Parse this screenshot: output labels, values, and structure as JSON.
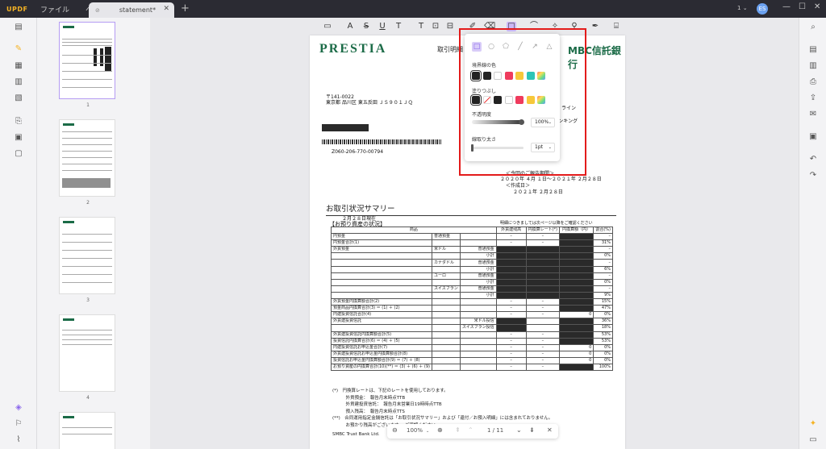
{
  "app": {
    "logo": "UPDF",
    "menus": [
      "ファイル",
      "ヘルプ"
    ],
    "tab_title": "statement*",
    "tab_close": "✕",
    "tab_add": "+",
    "user_count": "1",
    "avatar_initials": "ES",
    "win_min": "—",
    "win_max": "☐",
    "win_close": "✕"
  },
  "thumbnails": {
    "pages": [
      "1",
      "2",
      "3",
      "4"
    ]
  },
  "popup": {
    "border_color_label": "境界線の色",
    "fill_label": "塗りつぶし",
    "opacity_label": "不透明度",
    "opacity_value": "100%",
    "stroke_width_label": "線取り太さ",
    "stroke_width_value": "1pt",
    "border_colors": [
      "#222222",
      "#222222",
      "#ffffff",
      "#ef3b5d",
      "#f7c83a",
      "#2ec4b6",
      "#7a6cf0"
    ],
    "fill_colors": [
      "#222222",
      "none",
      "#222222",
      "#ffffff",
      "#ef3b5d",
      "#f7c83a",
      "#7a6cf0"
    ]
  },
  "document": {
    "brand": "PRESTIA",
    "doc_title": "取引明細",
    "bank": "MBC信託銀行",
    "postal": "〒141-0022",
    "address": "東京都 品川区 東五反田 ＪＳ９０１ＪＱ",
    "code": "Z060-206-770-00794",
    "right1": "ライン",
    "right2": "バンキング",
    "period_label": "＜今回のご報告期間＞",
    "period": "２０２０年 ４月 １日～２０２１年 ２月２８日",
    "created_label": "＜作成日＞",
    "created": "２０２１年 ２月２８日",
    "section_title": "お取引状況サマリー",
    "as_of": "２月２８日現在",
    "holdings_title": "【お預り資産の状況】",
    "holdings_note": "明細につきましては次ページ以降をご確認ください",
    "table_headers": [
      "商品",
      "外貨建残高",
      "円換算レート(*)",
      "円換算額（円）",
      "割合(%)"
    ],
    "rows": [
      [
        "円預金",
        "普通預金",
        "",
        "–",
        "–",
        "",
        "–"
      ],
      [
        "円預金合計(1)",
        "",
        "",
        "–",
        "–",
        "",
        "31%"
      ],
      [
        "外貨預金",
        "米ドル",
        "普通預金",
        "",
        "",
        "",
        "–"
      ],
      [
        "",
        "",
        "小計",
        "",
        "",
        "",
        "0%"
      ],
      [
        "",
        "カナダドル",
        "普通預金",
        "",
        "",
        "",
        "–"
      ],
      [
        "",
        "",
        "小計",
        "",
        "",
        "",
        "6%"
      ],
      [
        "",
        "ユーロ",
        "普通預金",
        "",
        "",
        "",
        "–"
      ],
      [
        "",
        "",
        "小計",
        "",
        "",
        "",
        "0%"
      ],
      [
        "",
        "スイスフラン",
        "普通預金",
        "",
        "",
        "",
        "–"
      ],
      [
        "",
        "",
        "小計",
        "",
        "",
        "",
        "9%"
      ],
      [
        "外貨預金円換算額合計(2)",
        "",
        "",
        "–",
        "–",
        "",
        "15%"
      ],
      [
        "預金商品円換算合計(3) ＝ (1) ＋ (2)",
        "",
        "",
        "–",
        "–",
        "",
        "47%"
      ],
      [
        "円建投資信託合計(4)",
        "",
        "",
        "–",
        "–",
        "0",
        "0%"
      ],
      [
        "外貨建投資信託",
        "",
        "米ドル投信",
        "",
        "",
        "",
        "36%"
      ],
      [
        "",
        "",
        "スイスフラン投信",
        "",
        "",
        "",
        "18%"
      ],
      [
        "外貨建投資信託円換算額合計(5)",
        "",
        "",
        "–",
        "–",
        "",
        "53%"
      ],
      [
        "投資信託円換算合計(6) ＝ (4) ＋ (5)",
        "",
        "",
        "–",
        "–",
        "",
        "53%"
      ],
      [
        "円建投資信託お申込金合計(7)",
        "",
        "",
        "–",
        "–",
        "0",
        "0%"
      ],
      [
        "外貨建投資信託お申込金円換算額合計(8)",
        "",
        "",
        "–",
        "–",
        "0",
        "0%"
      ],
      [
        "投資信託お申込金円換算額合計(9) ＝ (7) ＋ (8)",
        "",
        "",
        "–",
        "–",
        "0",
        "0%"
      ],
      [
        "お預り資産の円換算合計(10)(**) ＝ (3) ＋ (6) ＋ (9)",
        "",
        "",
        "–",
        "–",
        "",
        "100%"
      ]
    ],
    "notes": [
      "(*)　円換算レートは、下記のレートを使用しております。",
      "　　　外貨預金：　報告月末時点TTB",
      "　　　外貨建投資信託：　報告月末営業日19時時点TTB",
      "　　　預入残高：　報告月末時点TTS",
      "(**)　合同運用指定金銭信託は「お取引状況サマリー」および「還付／お預入明細」には含まれておりません。",
      "　　　お預かり残高がございます… ご確認ください。"
    ],
    "footer": "SMBC Trust Bank Ltd."
  },
  "bottombar": {
    "zoom": "100%",
    "page_indicator": "1 / 11"
  }
}
